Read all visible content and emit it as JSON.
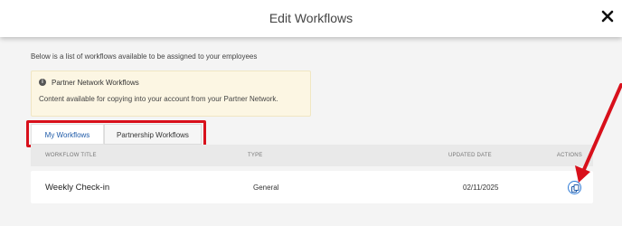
{
  "modal": {
    "title": "Edit Workflows",
    "close_icon": "close-icon"
  },
  "intro_text": "Below is a list of workflows available to be assigned to your employees",
  "info": {
    "icon": "info-icon",
    "title": "Partner Network Workflows",
    "body": "Content available for copying into your account from your Partner Network."
  },
  "tabs": [
    {
      "label": "My Workflows",
      "selected": false
    },
    {
      "label": "Partnership Workflows",
      "selected": true
    }
  ],
  "table": {
    "columns": [
      "WORKFLOW TITLE",
      "TYPE",
      "UPDATED DATE",
      "ACTIONS"
    ],
    "rows": [
      {
        "title": "Weekly Check-in",
        "type": "General",
        "updated": "02/11/2025",
        "action_icon": "copy-icon"
      }
    ]
  },
  "colors": {
    "annotation_red": "#d8101b",
    "link_blue": "#1e5aa8",
    "info_bg": "#fcf6e3"
  }
}
